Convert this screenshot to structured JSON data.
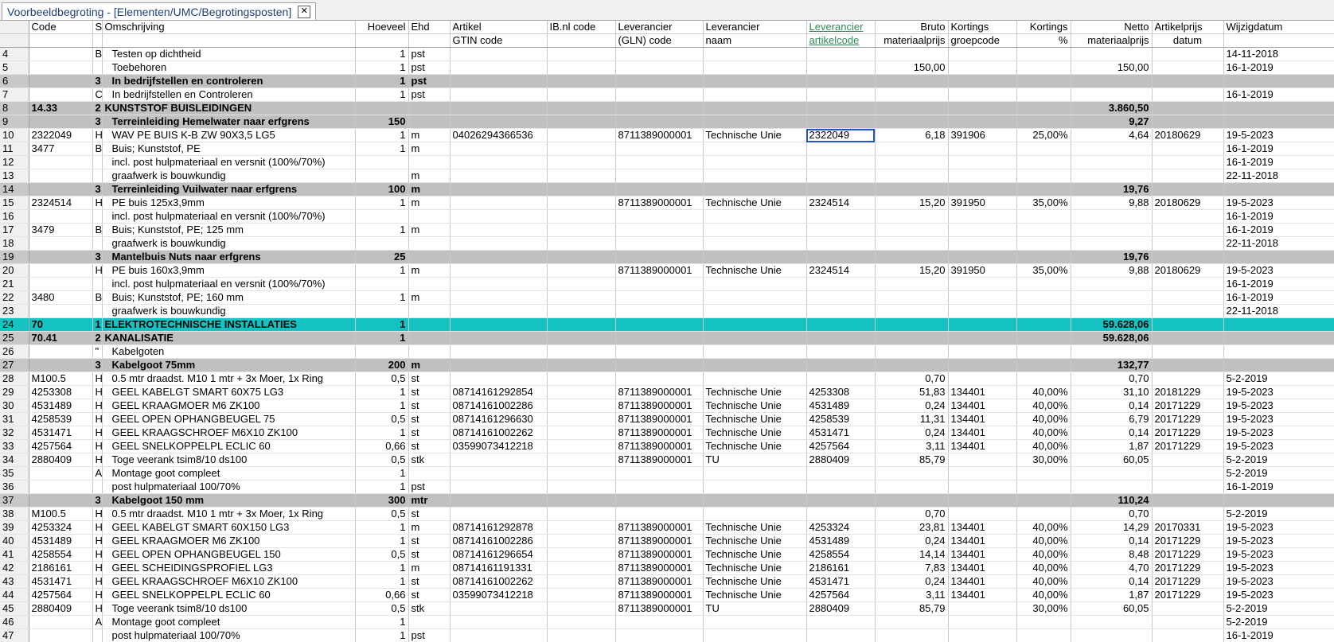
{
  "tab": {
    "title": "Voorbeeldbegroting - [Elementen/UMC/Begrotingsposten]",
    "close": "✕"
  },
  "header1": [
    "",
    "Code",
    "S",
    "Omschrijving",
    "Hoeveel",
    "Ehd",
    "Artikel",
    "IB.nl code",
    "Leverancier",
    "Leverancier",
    "Leverancier",
    "Bruto",
    "Kortings",
    "Kortings",
    "Netto",
    "Artikelprijs",
    "Wijzigdatum"
  ],
  "header2": [
    "",
    "",
    "",
    "",
    "",
    "",
    "GTIN code",
    "",
    "(GLN) code",
    "naam",
    "artikelcode",
    "materiaalprijs",
    "groepcode",
    "%",
    "materiaalprijs",
    "datum",
    ""
  ],
  "rows": [
    {
      "t": "",
      "c": [
        "4",
        "",
        "B",
        "Testen op dichtheid",
        "1",
        "pst",
        "",
        "",
        "",
        "",
        "",
        "",
        "",
        "",
        "",
        "",
        "14-11-2018"
      ]
    },
    {
      "t": "",
      "c": [
        "5",
        "",
        "",
        "Toebehoren",
        "1",
        "pst",
        "",
        "",
        "",
        "",
        "",
        "150,00",
        "",
        "",
        "150,00",
        "",
        "16-1-2019"
      ]
    },
    {
      "t": "gray",
      "c": [
        "6",
        "",
        "3",
        "In bedrijfstellen en controleren",
        "1",
        "pst",
        "",
        "",
        "",
        "",
        "",
        "",
        "",
        "",
        "",
        "",
        ""
      ]
    },
    {
      "t": "",
      "c": [
        "7",
        "",
        "C",
        "In bedrijfstellen en Controleren",
        "1",
        "pst",
        "",
        "",
        "",
        "",
        "",
        "",
        "",
        "",
        "",
        "",
        "16-1-2019"
      ]
    },
    {
      "t": "gray",
      "c": [
        "8",
        "14.33",
        "2",
        "KUNSTSTOF BUISLEIDINGEN",
        "",
        "",
        "",
        "",
        "",
        "",
        "",
        "",
        "",
        "",
        "3.860,50",
        "",
        ""
      ]
    },
    {
      "t": "gray",
      "c": [
        "9",
        "",
        "3",
        "Terreinleiding Hemelwater naar erfgrens",
        "150",
        "",
        "",
        "",
        "",
        "",
        "",
        "",
        "",
        "",
        "9,27",
        "",
        ""
      ]
    },
    {
      "t": "",
      "c": [
        "10",
        "2322049",
        "H",
        "WAV PE BUIS K-B ZW 90X3,5  LG5",
        "1",
        "m",
        "04026294366536",
        "",
        "8711389000001",
        "Technische Unie",
        "2322049",
        "6,18",
        "391906",
        "25,00%",
        "4,64",
        "20180629",
        "19-5-2023"
      ]
    },
    {
      "t": "",
      "c": [
        "11",
        "3477",
        "B",
        "Buis; Kunststof, PE",
        "1",
        "m",
        "",
        "",
        "",
        "",
        "",
        "",
        "",
        "",
        "",
        "",
        "16-1-2019"
      ]
    },
    {
      "t": "",
      "c": [
        "12",
        "",
        "",
        "incl. post hulpmateriaal en versnit (100%/70%)",
        "",
        "",
        "",
        "",
        "",
        "",
        "",
        "",
        "",
        "",
        "",
        "",
        "16-1-2019"
      ]
    },
    {
      "t": "",
      "c": [
        "13",
        "",
        "",
        "graafwerk is bouwkundig",
        "",
        "m",
        "",
        "",
        "",
        "",
        "",
        "",
        "",
        "",
        "",
        "",
        "22-11-2018"
      ]
    },
    {
      "t": "gray",
      "c": [
        "14",
        "",
        "3",
        "Terreinleiding Vuilwater naar erfgrens",
        "100",
        "m",
        "",
        "",
        "",
        "",
        "",
        "",
        "",
        "",
        "19,76",
        "",
        ""
      ]
    },
    {
      "t": "",
      "c": [
        "15",
        "2324514",
        "H",
        "PE buis 125x3,9mm",
        "1",
        "m",
        "",
        "",
        "8711389000001",
        "Technische Unie",
        "2324514",
        "15,20",
        "391950",
        "35,00%",
        "9,88",
        "20180629",
        "19-5-2023"
      ]
    },
    {
      "t": "",
      "c": [
        "16",
        "",
        "",
        "incl. post hulpmateriaal en versnit (100%/70%)",
        "",
        "",
        "",
        "",
        "",
        "",
        "",
        "",
        "",
        "",
        "",
        "",
        "16-1-2019"
      ]
    },
    {
      "t": "",
      "c": [
        "17",
        "3479",
        "B",
        "Buis; Kunststof, PE; 125 mm",
        "1",
        "m",
        "",
        "",
        "",
        "",
        "",
        "",
        "",
        "",
        "",
        "",
        "16-1-2019"
      ]
    },
    {
      "t": "",
      "c": [
        "18",
        "",
        "",
        "graafwerk is bouwkundig",
        "",
        "",
        "",
        "",
        "",
        "",
        "",
        "",
        "",
        "",
        "",
        "",
        "22-11-2018"
      ]
    },
    {
      "t": "gray",
      "c": [
        "19",
        "",
        "3",
        "Mantelbuis Nuts naar erfgrens",
        "25",
        "",
        "",
        "",
        "",
        "",
        "",
        "",
        "",
        "",
        "19,76",
        "",
        ""
      ]
    },
    {
      "t": "",
      "c": [
        "20",
        "",
        "H",
        "PE buis 160x3,9mm",
        "1",
        "m",
        "",
        "",
        "8711389000001",
        "Technische Unie",
        "2324514",
        "15,20",
        "391950",
        "35,00%",
        "9,88",
        "20180629",
        "19-5-2023"
      ]
    },
    {
      "t": "",
      "c": [
        "21",
        "",
        "",
        "incl. post hulpmateriaal en versnit (100%/70%)",
        "",
        "",
        "",
        "",
        "",
        "",
        "",
        "",
        "",
        "",
        "",
        "",
        "16-1-2019"
      ]
    },
    {
      "t": "",
      "c": [
        "22",
        "3480",
        "B",
        "Buis; Kunststof, PE; 160 mm",
        "1",
        "m",
        "",
        "",
        "",
        "",
        "",
        "",
        "",
        "",
        "",
        "",
        "16-1-2019"
      ]
    },
    {
      "t": "",
      "c": [
        "23",
        "",
        "",
        "graafwerk is bouwkundig",
        "",
        "",
        "",
        "",
        "",
        "",
        "",
        "",
        "",
        "",
        "",
        "",
        "22-11-2018"
      ]
    },
    {
      "t": "teal",
      "c": [
        "24",
        "70",
        "1",
        "ELEKTROTECHNISCHE INSTALLATIES",
        "1",
        "",
        "",
        "",
        "",
        "",
        "",
        "",
        "",
        "",
        "59.628,06",
        "",
        ""
      ]
    },
    {
      "t": "gray",
      "c": [
        "25",
        "70.41",
        "2",
        "KANALISATIE",
        "1",
        "",
        "",
        "",
        "",
        "",
        "",
        "",
        "",
        "",
        "59.628,06",
        "",
        ""
      ]
    },
    {
      "t": "",
      "c": [
        "26",
        "",
        "\"",
        "Kabelgoten",
        "",
        "",
        "",
        "",
        "",
        "",
        "",
        "",
        "",
        "",
        "",
        "",
        ""
      ]
    },
    {
      "t": "gray",
      "c": [
        "27",
        "",
        "3",
        "Kabelgoot 75mm",
        "200",
        "m",
        "",
        "",
        "",
        "",
        "",
        "",
        "",
        "",
        "132,77",
        "",
        ""
      ]
    },
    {
      "t": "",
      "c": [
        "28",
        "M100.5",
        "H",
        "0.5 mtr draadst. M10 1 mtr + 3x Moer, 1x Ring",
        "0,5",
        "st",
        "",
        "",
        "",
        "",
        "",
        "0,70",
        "",
        "",
        "0,70",
        "",
        "5-2-2019"
      ]
    },
    {
      "t": "",
      "c": [
        "29",
        "4253308",
        "H",
        "GEEL KABELGT SMART 60X75   LG3",
        "1",
        "st",
        "08714161292854",
        "",
        "8711389000001",
        "Technische Unie",
        "4253308",
        "51,83",
        "134401",
        "40,00%",
        "31,10",
        "20181229",
        "19-5-2023"
      ]
    },
    {
      "t": "",
      "c": [
        "30",
        "4531489",
        "H",
        "GEEL KRAAGMOER M6         ZK100",
        "1",
        "st",
        "08714161002286",
        "",
        "8711389000001",
        "Technische Unie",
        "4531489",
        "0,24",
        "134401",
        "40,00%",
        "0,14",
        "20171229",
        "19-5-2023"
      ]
    },
    {
      "t": "",
      "c": [
        "31",
        "4258539",
        "H",
        "GEEL OPEN OPHANGBEUGEL 75",
        "0,5",
        "st",
        "08714161296630",
        "",
        "8711389000001",
        "Technische Unie",
        "4258539",
        "11,31",
        "134401",
        "40,00%",
        "6,79",
        "20171229",
        "19-5-2023"
      ]
    },
    {
      "t": "",
      "c": [
        "32",
        "4531471",
        "H",
        "GEEL KRAAGSCHROEF M6X10  ZK100",
        "1",
        "st",
        "08714161002262",
        "",
        "8711389000001",
        "Technische Unie",
        "4531471",
        "0,24",
        "134401",
        "40,00%",
        "0,14",
        "20171229",
        "19-5-2023"
      ]
    },
    {
      "t": "",
      "c": [
        "33",
        "4257564",
        "H",
        "GEEL SNELKOPPELPL ECLIC 60",
        "0,66",
        "st",
        "03599073412218",
        "",
        "8711389000001",
        "Technische Unie",
        "4257564",
        "3,11",
        "134401",
        "40,00%",
        "1,87",
        "20171229",
        "19-5-2023"
      ]
    },
    {
      "t": "",
      "c": [
        "34",
        "2880409",
        "H",
        "Toge veerank  tsim8/10  ds100",
        "0,5",
        "stk",
        "",
        "",
        "8711389000001",
        "TU",
        "2880409",
        "85,79",
        "",
        "30,00%",
        "60,05",
        "",
        "5-2-2019"
      ]
    },
    {
      "t": "",
      "c": [
        "35",
        "",
        "A",
        "Montage goot compleet",
        "1",
        "",
        "",
        "",
        "",
        "",
        "",
        "",
        "",
        "",
        "",
        "",
        "5-2-2019"
      ]
    },
    {
      "t": "",
      "c": [
        "36",
        "",
        "",
        "post hulpmateriaal 100/70%",
        "1",
        "pst",
        "",
        "",
        "",
        "",
        "",
        "",
        "",
        "",
        "",
        "",
        "16-1-2019"
      ]
    },
    {
      "t": "gray",
      "c": [
        "37",
        "",
        "3",
        "Kabelgoot 150 mm",
        "300",
        "mtr",
        "",
        "",
        "",
        "",
        "",
        "",
        "",
        "",
        "110,24",
        "",
        ""
      ]
    },
    {
      "t": "",
      "c": [
        "38",
        "M100.5",
        "H",
        "0.5 mtr draadst. M10 1 mtr + 3x Moer, 1x Ring",
        "0,5",
        "st",
        "",
        "",
        "",
        "",
        "",
        "0,70",
        "",
        "",
        "0,70",
        "",
        "5-2-2019"
      ]
    },
    {
      "t": "",
      "c": [
        "39",
        "4253324",
        "H",
        "GEEL KABELGT SMART 60X150  LG3",
        "1",
        "m",
        "08714161292878",
        "",
        "8711389000001",
        "Technische Unie",
        "4253324",
        "23,81",
        "134401",
        "40,00%",
        "14,29",
        "20170331",
        "19-5-2023"
      ]
    },
    {
      "t": "",
      "c": [
        "40",
        "4531489",
        "H",
        "GEEL KRAAGMOER M6         ZK100",
        "1",
        "st",
        "08714161002286",
        "",
        "8711389000001",
        "Technische Unie",
        "4531489",
        "0,24",
        "134401",
        "40,00%",
        "0,14",
        "20171229",
        "19-5-2023"
      ]
    },
    {
      "t": "",
      "c": [
        "41",
        "4258554",
        "H",
        "GEEL OPEN OPHANGBEUGEL 150",
        "0,5",
        "st",
        "08714161296654",
        "",
        "8711389000001",
        "Technische Unie",
        "4258554",
        "14,14",
        "134401",
        "40,00%",
        "8,48",
        "20171229",
        "19-5-2023"
      ]
    },
    {
      "t": "",
      "c": [
        "42",
        "2186161",
        "H",
        "GEEL SCHEIDINGSPROFIEL     LG3",
        "1",
        "m",
        "08714161191331",
        "",
        "8711389000001",
        "Technische Unie",
        "2186161",
        "7,83",
        "134401",
        "40,00%",
        "4,70",
        "20171229",
        "19-5-2023"
      ]
    },
    {
      "t": "",
      "c": [
        "43",
        "4531471",
        "H",
        "GEEL KRAAGSCHROEF M6X10  ZK100",
        "1",
        "st",
        "08714161002262",
        "",
        "8711389000001",
        "Technische Unie",
        "4531471",
        "0,24",
        "134401",
        "40,00%",
        "0,14",
        "20171229",
        "19-5-2023"
      ]
    },
    {
      "t": "",
      "c": [
        "44",
        "4257564",
        "H",
        "GEEL SNELKOPPELPL ECLIC 60",
        "0,66",
        "st",
        "03599073412218",
        "",
        "8711389000001",
        "Technische Unie",
        "4257564",
        "3,11",
        "134401",
        "40,00%",
        "1,87",
        "20171229",
        "19-5-2023"
      ]
    },
    {
      "t": "",
      "c": [
        "45",
        "2880409",
        "H",
        "Toge veerank  tsim8/10  ds100",
        "0,5",
        "stk",
        "",
        "",
        "8711389000001",
        "TU",
        "2880409",
        "85,79",
        "",
        "30,00%",
        "60,05",
        "",
        "5-2-2019"
      ]
    },
    {
      "t": "",
      "c": [
        "46",
        "",
        "A",
        "Montage goot compleet",
        "1",
        "",
        "",
        "",
        "",
        "",
        "",
        "",
        "",
        "",
        "",
        "",
        "5-2-2019"
      ]
    },
    {
      "t": "",
      "c": [
        "47",
        "",
        "",
        "post hulpmateriaal 100/70%",
        "1",
        "pst",
        "",
        "",
        "",
        "",
        "",
        "",
        "",
        "",
        "",
        "",
        "16-1-2019"
      ]
    }
  ],
  "selected_cell": {
    "row": "10",
    "column": "Leverancier artikelcode"
  },
  "colors": {
    "section": "#c0c0c0",
    "group": "#14c2c2",
    "selection": "#2255cc",
    "active_header": "#2e8b57"
  }
}
